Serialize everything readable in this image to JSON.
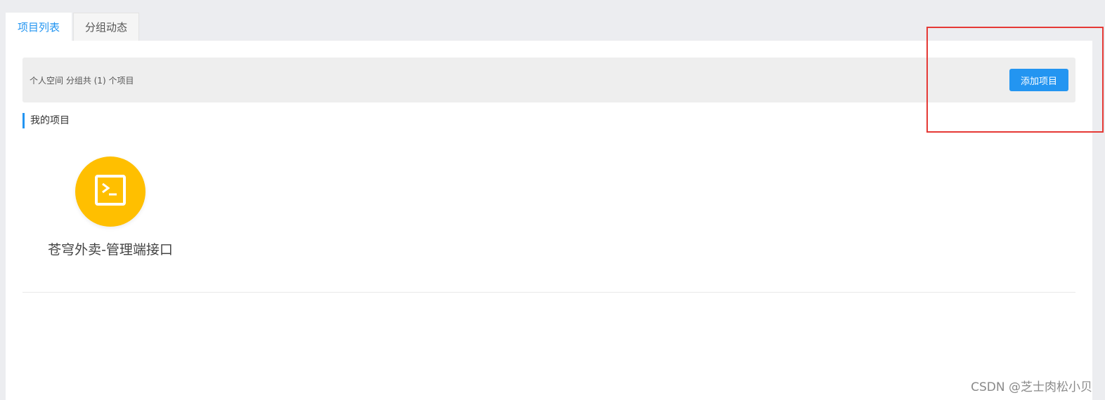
{
  "tabs": [
    {
      "label": "项目列表",
      "active": true
    },
    {
      "label": "分组动态",
      "active": false
    }
  ],
  "info_bar": {
    "text": "个人空间 分组共 (1) 个项目",
    "add_button_label": "添加项目"
  },
  "section": {
    "title": "我的项目"
  },
  "projects": [
    {
      "name": "苍穹外卖-管理端接口",
      "icon": "terminal-icon",
      "color": "#ffbf00"
    }
  ],
  "watermark": "CSDN @芝士肉松小贝",
  "colors": {
    "accent": "#2395f1",
    "highlight": "#e53935"
  }
}
